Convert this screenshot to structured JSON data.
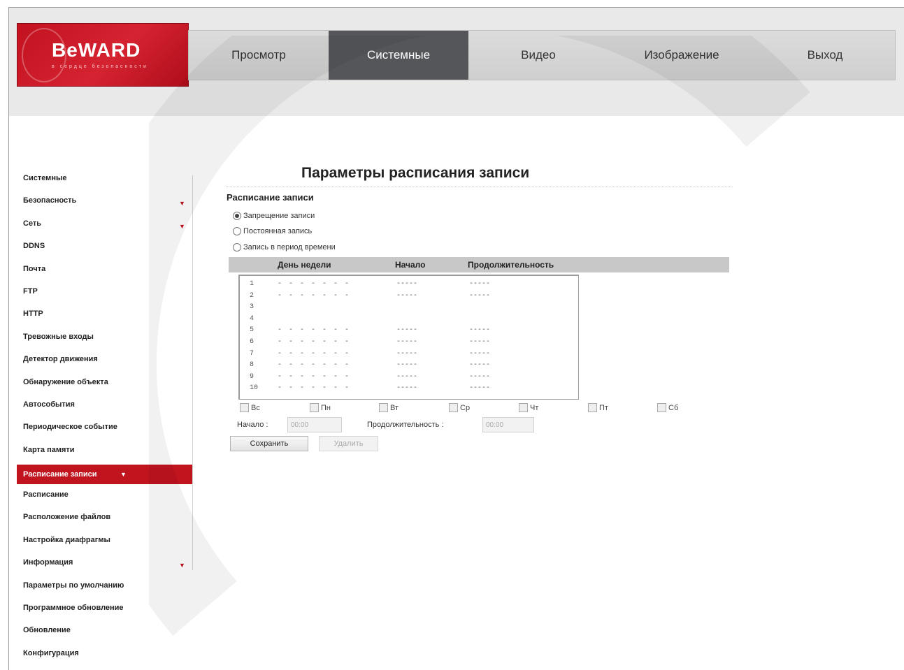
{
  "brand": {
    "name": "BeWARD",
    "tagline": "в сердце безопасности"
  },
  "nav": {
    "items": [
      {
        "label": "Просмотр",
        "active": false
      },
      {
        "label": "Системные",
        "active": true
      },
      {
        "label": "Видео",
        "active": false
      },
      {
        "label": "Изображение",
        "active": false
      },
      {
        "label": "Выход",
        "active": false
      }
    ]
  },
  "sidebar": {
    "items": [
      {
        "label": "Системные",
        "has_arrow": false,
        "active": false
      },
      {
        "label": "Безопасность",
        "has_arrow": true,
        "active": false
      },
      {
        "label": "Сеть",
        "has_arrow": true,
        "active": false
      },
      {
        "label": "DDNS",
        "has_arrow": false,
        "active": false
      },
      {
        "label": "Почта",
        "has_arrow": false,
        "active": false
      },
      {
        "label": "FTP",
        "has_arrow": false,
        "active": false
      },
      {
        "label": "HTTP",
        "has_arrow": false,
        "active": false
      },
      {
        "label": "Тревожные входы",
        "has_arrow": false,
        "active": false
      },
      {
        "label": "Детектор движения",
        "has_arrow": false,
        "active": false
      },
      {
        "label": "Обнаружение объекта",
        "has_arrow": false,
        "active": false
      },
      {
        "label": "Автособытия",
        "has_arrow": false,
        "active": false
      },
      {
        "label": "Периодическое событие",
        "has_arrow": false,
        "active": false
      },
      {
        "label": "Карта памяти",
        "has_arrow": false,
        "active": false
      },
      {
        "label": "Расписание записи",
        "has_arrow": true,
        "active": true
      },
      {
        "label": "Расписание",
        "has_arrow": false,
        "active": false
      },
      {
        "label": "Расположение файлов",
        "has_arrow": false,
        "active": false
      },
      {
        "label": "Настройка диафрагмы",
        "has_arrow": false,
        "active": false
      },
      {
        "label": "Информация",
        "has_arrow": true,
        "active": false
      },
      {
        "label": "Параметры по умолчанию",
        "has_arrow": false,
        "active": false
      },
      {
        "label": "Программное обновление",
        "has_arrow": false,
        "active": false
      },
      {
        "label": "Обновление",
        "has_arrow": false,
        "active": false
      },
      {
        "label": "Конфигурация",
        "has_arrow": false,
        "active": false
      }
    ],
    "arrow_glyph": "▼"
  },
  "page": {
    "title": "Параметры расписания записи",
    "section_title": "Расписание записи",
    "radios": [
      {
        "label": "Запрещение записи",
        "checked": true
      },
      {
        "label": "Постоянная запись",
        "checked": false
      },
      {
        "label": "Запись в период времени",
        "checked": false
      }
    ]
  },
  "schedule": {
    "headers": {
      "day": "День недели",
      "start": "Начало",
      "duration": "Продолжительность"
    },
    "rows": [
      {
        "idx": "1",
        "days": "- - - - - - -",
        "start": "-----",
        "duration": "-----"
      },
      {
        "idx": "2",
        "days": "- - - - - - -",
        "start": "-----",
        "duration": "-----"
      },
      {
        "idx": "3",
        "days": "",
        "start": "",
        "duration": ""
      },
      {
        "idx": "4",
        "days": "",
        "start": "",
        "duration": ""
      },
      {
        "idx": "5",
        "days": "- - - - - - -",
        "start": "-----",
        "duration": "-----"
      },
      {
        "idx": "6",
        "days": "- - - - - - -",
        "start": "-----",
        "duration": "-----"
      },
      {
        "idx": "7",
        "days": "- - - - - - -",
        "start": "-----",
        "duration": "-----"
      },
      {
        "idx": "8",
        "days": "- - - - - - -",
        "start": "-----",
        "duration": "-----"
      },
      {
        "idx": "9",
        "days": "- - - - - - -",
        "start": "-----",
        "duration": "-----"
      },
      {
        "idx": "10",
        "days": "- - - - - - -",
        "start": "-----",
        "duration": "-----"
      }
    ]
  },
  "weekdays": [
    "Вс",
    "Пн",
    "Вт",
    "Ср",
    "Чт",
    "Пт",
    "Сб"
  ],
  "form": {
    "start_label": "Начало :",
    "start_value": "00:00",
    "duration_label": "Продолжительность :",
    "duration_value": "00:00",
    "save_label": "Сохранить",
    "delete_label": "Удалить"
  }
}
